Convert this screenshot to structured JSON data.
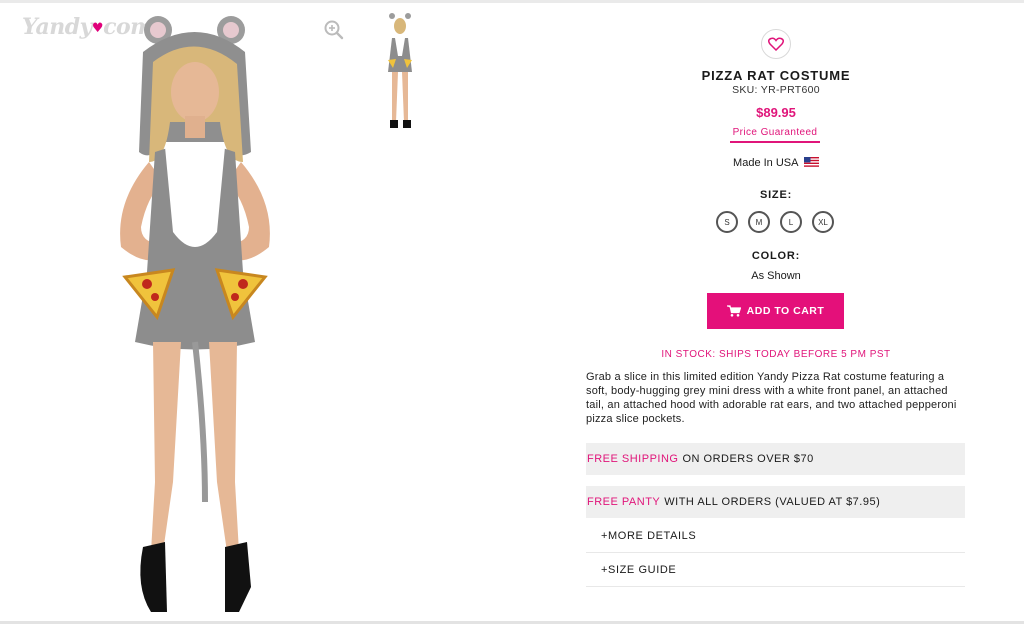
{
  "brand": {
    "logo_text": "Yandy",
    "logo_suffix": "com"
  },
  "gallery": {
    "zoom_icon": "magnifier-plus-icon"
  },
  "product": {
    "title": "PIZZA RAT COSTUME",
    "sku": "SKU: YR-PRT600",
    "price": "$89.95",
    "price_guarantee": "Price Guaranteed",
    "made_in": "Made In USA",
    "size_label": "SIZE:",
    "sizes": [
      "S",
      "M",
      "L",
      "XL"
    ],
    "color_label": "COLOR:",
    "color_value": "As Shown",
    "add_to_cart": "ADD TO CART",
    "stock_status": "IN STOCK: SHIPS TODAY BEFORE 5 PM PST",
    "description": "Grab a slice in this limited edition Yandy Pizza Rat costume featuring a soft, body-hugging grey mini dress with a white front panel, an attached tail, an attached hood with adorable rat ears, and two attached pepperoni pizza slice pockets."
  },
  "promos": [
    {
      "highlight": "FREE SHIPPING",
      "text": "ON ORDERS OVER $70"
    },
    {
      "highlight": "FREE PANTY",
      "text": "WITH ALL ORDERS (VALUED AT $7.95)"
    }
  ],
  "accordions": [
    {
      "label": "+MORE DETAILS"
    },
    {
      "label": "+SIZE GUIDE"
    }
  ],
  "colors": {
    "accent": "#e4107a",
    "promo_bg": "#efefef"
  }
}
